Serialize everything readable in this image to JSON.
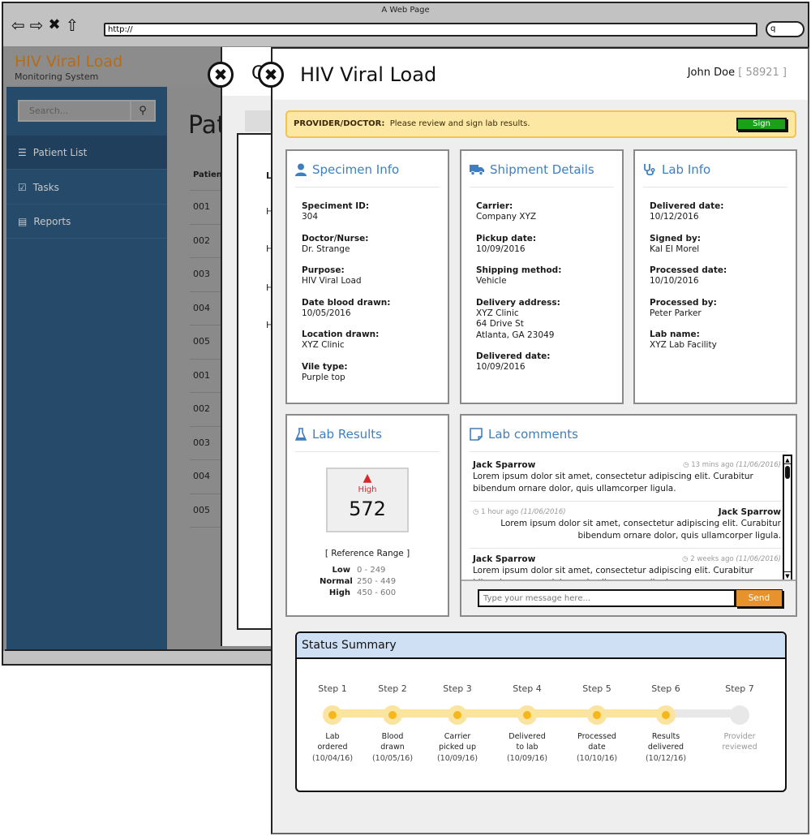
{
  "browser": {
    "title": "A Web Page",
    "url": "http://",
    "nav_icons": [
      "back-arrow-icon",
      "forward-arrow-icon",
      "stop-icon",
      "home-icon"
    ],
    "search_glyph": "q"
  },
  "background_app": {
    "logo": "HIV Viral Load",
    "subtitle": "Monitoring System",
    "search_placeholder": "Search...",
    "sidebar": [
      {
        "label": "Patient List",
        "icon": "list-icon",
        "active": true
      },
      {
        "label": "Tasks",
        "icon": "checkbox-icon",
        "active": false
      },
      {
        "label": "Reports",
        "icon": "document-icon",
        "active": false
      }
    ],
    "page_title": "Pat",
    "table_header": "Patient",
    "table_rows": [
      "001",
      "002",
      "003",
      "004",
      "005",
      "001",
      "002",
      "003",
      "004",
      "005"
    ],
    "mid_modal_title_fragment": "C",
    "mid_modal_col_header": "L",
    "mid_modal_rows": [
      "H",
      "H",
      "H",
      "H"
    ]
  },
  "modal": {
    "title": "HIV Viral Load",
    "patient_name": "John Doe",
    "patient_id": "[ 58921 ]",
    "alert": {
      "role": "PROVIDER/DOCTOR:",
      "message": "Please review and sign lab results.",
      "button": "Sign"
    },
    "specimen": {
      "title": "Specimen Info",
      "icon": "user-icon",
      "fields": [
        {
          "label": "Speciment ID:",
          "value": "304"
        },
        {
          "label": "Doctor/Nurse:",
          "value": "Dr. Strange"
        },
        {
          "label": "Purpose:",
          "value": "HIV Viral Load"
        },
        {
          "label": "Date blood drawn:",
          "value": "10/05/2016"
        },
        {
          "label": "Location drawn:",
          "value": "XYZ Clinic"
        },
        {
          "label": "Vile type:",
          "value": "Purple top"
        }
      ]
    },
    "shipment": {
      "title": "Shipment Details",
      "icon": "truck-icon",
      "fields": [
        {
          "label": "Carrier:",
          "value": "Company XYZ"
        },
        {
          "label": "Pickup date:",
          "value": "10/09/2016"
        },
        {
          "label": "Shipping method:",
          "value": "Vehicle"
        },
        {
          "label": "Delivery address:",
          "value": "XYZ Clinic\n64 Drive St\nAtlanta, GA 23049"
        },
        {
          "label": "Delivered date:",
          "value": "10/09/2016"
        }
      ]
    },
    "lab_info": {
      "title": "Lab Info",
      "icon": "stethoscope-icon",
      "fields": [
        {
          "label": "Delivered date:",
          "value": "10/12/2016"
        },
        {
          "label": "Signed by:",
          "value": "Kal El Morel"
        },
        {
          "label": "Processed date:",
          "value": "10/10/2016"
        },
        {
          "label": "Processed by:",
          "value": "Peter Parker"
        },
        {
          "label": "Lab name:",
          "value": "XYZ Lab Facility"
        }
      ]
    },
    "lab_results": {
      "title": "Lab Results",
      "icon": "flask-icon",
      "flag": "High",
      "value": "572",
      "warning_icon": "warning-triangle-icon",
      "reference_title": "[ Reference Range ]",
      "reference": [
        {
          "name": "Low",
          "range": "0 - 249"
        },
        {
          "name": "Normal",
          "range": "250 - 449"
        },
        {
          "name": "High",
          "range": "450 - 600"
        }
      ]
    },
    "lab_comments": {
      "title": "Lab comments",
      "icon": "note-icon",
      "comments": [
        {
          "author": "Jack Sparrow",
          "ago": "13 mins ago",
          "date": "(11/06/2016)",
          "text": "Lorem ipsum dolor sit amet, consectetur adipiscing elit. Curabitur bibendum ornare dolor, quis ullamcorper ligula.",
          "align": "left"
        },
        {
          "author": "Jack Sparrow",
          "ago": "1 hour ago",
          "date": "(11/06/2016)",
          "text": "Lorem ipsum dolor sit amet, consectetur adipiscing elit. Curabitur bibendum ornare dolor, quis ullamcorper ligula.",
          "align": "right"
        },
        {
          "author": "Jack Sparrow",
          "ago": "2 weeks ago",
          "date": "(11/06/2016)",
          "text": "Lorem ipsum dolor sit amet, consectetur adipiscing elit. Curabitur bibendum ornare dolor, quis ullamcorper ligula.",
          "align": "left"
        }
      ],
      "input_placeholder": "Type your message here...",
      "send_label": "Send"
    },
    "status_summary": {
      "title": "Status Summary",
      "completed_steps": 6,
      "total_steps": 7,
      "steps": [
        {
          "label": "Step 1",
          "desc1": "Lab",
          "desc2": "ordered",
          "date": "(10/04/16)",
          "done": true
        },
        {
          "label": "Step 2",
          "desc1": "Blood",
          "desc2": "drawn",
          "date": "(10/05/16)",
          "done": true
        },
        {
          "label": "Step 3",
          "desc1": "Carrier",
          "desc2": "picked up",
          "date": "(10/09/16)",
          "done": true
        },
        {
          "label": "Step 4",
          "desc1": "Delivered",
          "desc2": "to lab",
          "date": "(10/09/16)",
          "done": true
        },
        {
          "label": "Step 5",
          "desc1": "Processed",
          "desc2": "date",
          "date": "(10/10/16)",
          "done": true
        },
        {
          "label": "Step 6",
          "desc1": "Results",
          "desc2": "delivered",
          "date": "(10/12/16)",
          "done": true
        },
        {
          "label": "Step 7",
          "desc1": "Provider",
          "desc2": "reviewed",
          "date": "",
          "done": false
        }
      ]
    }
  },
  "colors": {
    "accent_blue": "#3f7fbf",
    "logo_orange": "#b86b15",
    "alert_bg": "#fce7a3",
    "sign_green": "#1aa01a",
    "send_orange": "#e8922e",
    "high_red": "#d9252a",
    "step_done": "#f5b81c",
    "step_track": "#fbe3a0"
  }
}
